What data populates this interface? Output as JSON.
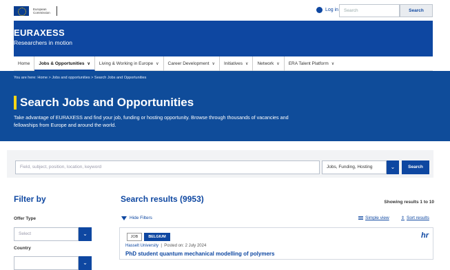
{
  "topbar": {
    "eu_logo_text": "European Commission",
    "login_label": "Log in",
    "search_placeholder": "Search",
    "search_button": "Search"
  },
  "banner": {
    "brand": "EURAXESS",
    "tagline": "Researchers in motion"
  },
  "nav": [
    {
      "label": "Home",
      "has_menu": false,
      "active": false
    },
    {
      "label": "Jobs & Opportunities",
      "has_menu": true,
      "active": true
    },
    {
      "label": "Living & Working in Europe",
      "has_menu": true,
      "active": false
    },
    {
      "label": "Career Development",
      "has_menu": true,
      "active": false
    },
    {
      "label": "Initiatives",
      "has_menu": true,
      "active": false
    },
    {
      "label": "Network",
      "has_menu": true,
      "active": false
    },
    {
      "label": "ERA Talent Platform",
      "has_menu": true,
      "active": false
    }
  ],
  "hero": {
    "breadcrumb": "You are here:  Home  >  Jobs and opportunities  >  Search Jobs and Opportunities",
    "title": "Search Jobs and Opportunities",
    "description": "Take advantage of EURAXESS and find your job, funding or hosting opportunity. Browse through thousands of vacancies and fellowships from Europe and around the world."
  },
  "search_panel": {
    "keyword_placeholder": "Field, subject, position, location, keyword",
    "type_value": "Jobs, Funding, Hosting",
    "search_button": "Search"
  },
  "filters": {
    "title": "Filter by",
    "offer_type_label": "Offer Type",
    "offer_type_value": "Select",
    "country_label": "Country"
  },
  "results": {
    "title": "Search results (9953)",
    "showing": "Showing results 1 to 10",
    "hide_filters": "Hide Filters",
    "simple_view": "Simple view",
    "sort_results": "Sort results"
  },
  "card": {
    "type_tag": "JOB",
    "country_tag": "BELGIUM",
    "organisation": "Hasselt University",
    "posted": "Posted on: 2 July 2024",
    "title": "PhD student quantum mechanical modelling of polymers",
    "logo_text": "hr"
  },
  "colors": {
    "brand_blue": "#0e47a1",
    "hero_blue": "#0f4c9a",
    "accent_yellow": "#ffd617"
  }
}
